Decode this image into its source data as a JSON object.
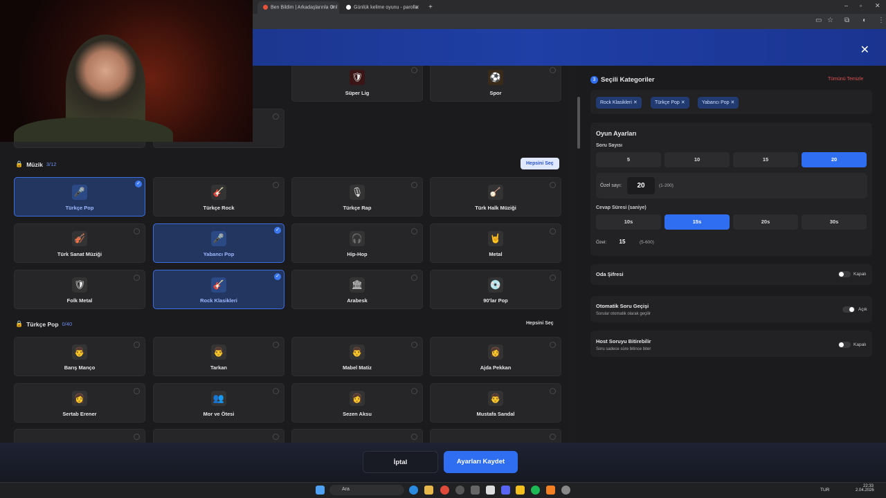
{
  "browser": {
    "tabs": [
      {
        "title": "Ben Bildim | Arkadaşlarınla Onl",
        "active": true
      },
      {
        "title": "Günlük kelime oyunu - parolla",
        "active": false
      }
    ],
    "new_tab": "+"
  },
  "close_label": "✕",
  "music": {
    "title": "Müzik",
    "count": "3/12",
    "select_all": "Hepsini Seç",
    "items": [
      {
        "label": "Türkçe Pop",
        "selected": true,
        "icon": "🎤"
      },
      {
        "label": "Türkçe Rock",
        "selected": false,
        "icon": "🎸"
      },
      {
        "label": "Türkçe Rap",
        "selected": false,
        "icon": "🎙"
      },
      {
        "label": "Türk Halk Müziği",
        "selected": false,
        "icon": "🪕"
      },
      {
        "label": "Türk Sanat Müziği",
        "selected": false,
        "icon": "🎻"
      },
      {
        "label": "Yabancı Pop",
        "selected": true,
        "icon": "🎤"
      },
      {
        "label": "Hip-Hop",
        "selected": false,
        "icon": "🎧"
      },
      {
        "label": "Metal",
        "selected": false,
        "icon": "🤘"
      },
      {
        "label": "Folk Metal",
        "selected": false,
        "icon": "🛡"
      },
      {
        "label": "Rock Klasikleri",
        "selected": true,
        "icon": "🎸"
      },
      {
        "label": "Arabesk",
        "selected": false,
        "icon": "🏛"
      },
      {
        "label": "90'lar Pop",
        "selected": false,
        "icon": "💿"
      }
    ]
  },
  "top_items": [
    {
      "label": "Süper Lig",
      "icon": "🛡"
    },
    {
      "label": "Spor",
      "icon": "⚽"
    }
  ],
  "turkce_pop": {
    "title": "Türkçe Pop",
    "count": "0/40",
    "select_all": "Hepsini Seç",
    "items": [
      {
        "label": "Barış Manço",
        "icon": "👨"
      },
      {
        "label": "Tarkan",
        "icon": "👨"
      },
      {
        "label": "Mabel Matiz",
        "icon": "👨"
      },
      {
        "label": "Ajda Pekkan",
        "icon": "👩"
      },
      {
        "label": "Sertab Erener",
        "icon": "👩"
      },
      {
        "label": "Mor ve Ötesi",
        "icon": "👥"
      },
      {
        "label": "Sezen Aksu",
        "icon": "👩"
      },
      {
        "label": "Mustafa Sandal",
        "icon": "👨"
      }
    ]
  },
  "selected": {
    "step": "3",
    "title": "Seçili Kategoriler",
    "clear": "Tümünü Temizle",
    "chips": [
      "Rock Klasikleri",
      "Türkçe Pop",
      "Yabancı Pop"
    ]
  },
  "settings": {
    "title": "Oyun Ayarları",
    "q_label": "Soru Sayısı",
    "q_options": [
      "5",
      "10",
      "15",
      "20"
    ],
    "q_selected": 3,
    "custom_label": "Özel sayı:",
    "custom_value": "20",
    "custom_range": "(1-200)",
    "t_label": "Cevap Süresi (saniye)",
    "t_options": [
      "10s",
      "15s",
      "20s",
      "30s"
    ],
    "t_selected": 1,
    "t_custom_label": "Özel:",
    "t_custom_value": "15",
    "t_custom_range": "(5-600)"
  },
  "password": {
    "label": "Oda Şifresi",
    "state": "Kapalı",
    "on": false
  },
  "auto": {
    "label": "Otomatik Soru Geçişi",
    "sub": "Sorular otomatik olarak geçilir",
    "state": "Açık",
    "on": true
  },
  "host": {
    "label": "Host Soruyu Bitirebilir",
    "sub": "Soru sadece süre bitince biter",
    "state": "Kapalı",
    "on": false
  },
  "footer": {
    "cancel": "İptal",
    "save": "Ayarları Kaydet"
  },
  "taskbar": {
    "search": "Ara",
    "lang": "TUR",
    "time": "22:33",
    "date": "2.04.2026"
  }
}
